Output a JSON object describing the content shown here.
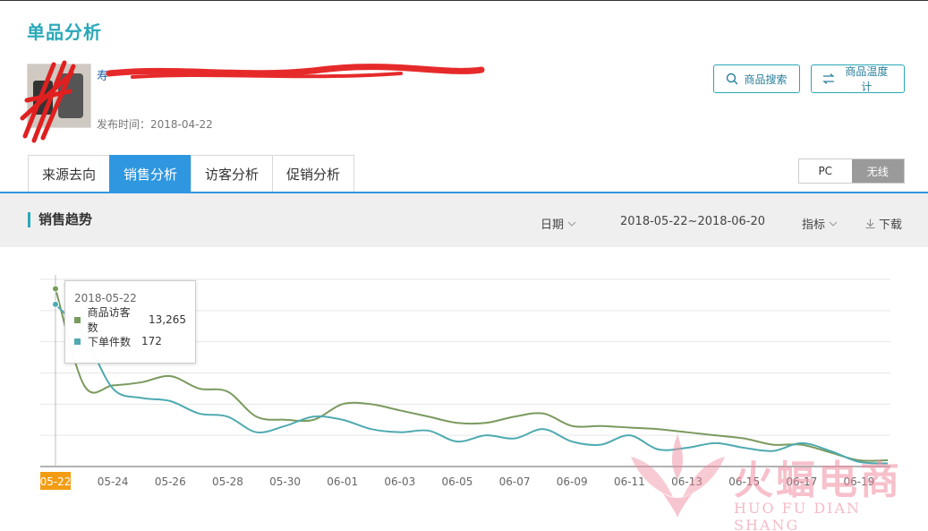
{
  "page": {
    "title": "单品分析"
  },
  "product": {
    "name": "寿",
    "publish_label": "发布时间：",
    "publish_date": "2018-04-22"
  },
  "header_buttons": {
    "search": "商品搜索",
    "thermometer": "商品温度计"
  },
  "tabs": [
    {
      "label": "来源去向",
      "active": false
    },
    {
      "label": "销售分析",
      "active": true
    },
    {
      "label": "访客分析",
      "active": false
    },
    {
      "label": "促销分析",
      "active": false
    }
  ],
  "device_toggle": {
    "options": [
      "PC",
      "无线"
    ],
    "selected": "无线"
  },
  "section": {
    "title": "销售趋势",
    "date_label": "日期",
    "date_range": "2018-05-22~2018-06-20",
    "metric_label": "指标",
    "download_label": "下载"
  },
  "tooltip": {
    "date": "2018-05-22",
    "rows": [
      {
        "name": "商品访客数",
        "value": "13,265",
        "color": "#7a9a5e"
      },
      {
        "name": "下单件数",
        "value": "172",
        "color": "#4eaab0"
      }
    ]
  },
  "watermark": {
    "text": "火蝠电商",
    "sub": "HUO FU DIAN SHANG"
  },
  "chart_data": {
    "type": "line",
    "x": [
      "05-22",
      "05-23",
      "05-24",
      "05-25",
      "05-26",
      "05-27",
      "05-28",
      "05-29",
      "05-30",
      "05-31",
      "06-01",
      "06-02",
      "06-03",
      "06-04",
      "06-05",
      "06-06",
      "06-07",
      "06-08",
      "06-09",
      "06-10",
      "06-11",
      "06-12",
      "06-13",
      "06-14",
      "06-15",
      "06-16",
      "06-17",
      "06-18",
      "06-19",
      "06-20"
    ],
    "xticks": [
      "05-22",
      "05-24",
      "05-26",
      "05-28",
      "05-30",
      "06-01",
      "06-03",
      "06-05",
      "06-07",
      "06-09",
      "06-11",
      "06-13",
      "06-15",
      "06-17",
      "06-19"
    ],
    "highlight_x": "05-22",
    "series": [
      {
        "name": "商品访客数",
        "color": "#7a9a5e",
        "values": [
          5.7,
          2.6,
          2.6,
          2.7,
          2.9,
          2.5,
          2.4,
          1.6,
          1.5,
          1.5,
          2.0,
          2.0,
          1.8,
          1.6,
          1.4,
          1.4,
          1.6,
          1.7,
          1.3,
          1.3,
          1.25,
          1.2,
          1.1,
          1.0,
          0.9,
          0.7,
          0.7,
          0.45,
          0.2,
          0.2
        ]
      },
      {
        "name": "下单件数",
        "color": "#4eaab0",
        "values": [
          5.2,
          4.2,
          2.5,
          2.2,
          2.1,
          1.7,
          1.6,
          1.1,
          1.3,
          1.6,
          1.5,
          1.2,
          1.1,
          1.15,
          0.8,
          1.0,
          0.9,
          1.2,
          0.8,
          0.7,
          1.0,
          0.55,
          0.6,
          0.75,
          0.6,
          0.5,
          0.75,
          0.5,
          0.15,
          0.1
        ]
      }
    ],
    "ylim": [
      0,
      6
    ],
    "grid": true
  }
}
